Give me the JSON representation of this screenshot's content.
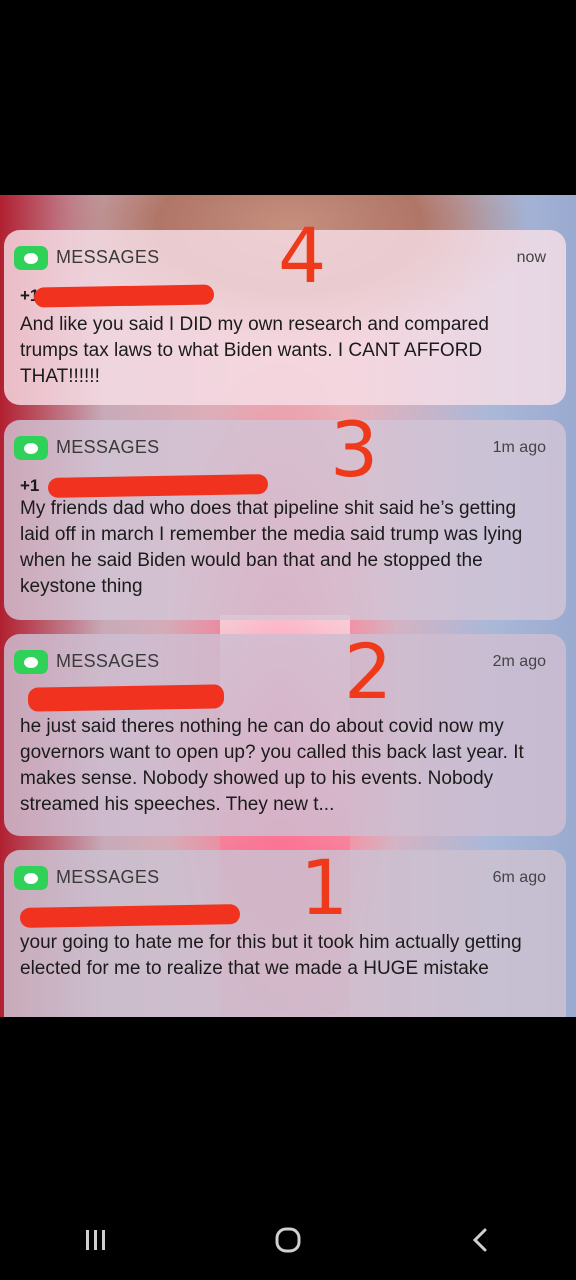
{
  "notifications": [
    {
      "app": "MESSAGES",
      "time": "now",
      "sender": "+1",
      "body": "And like you said I DID my own research and compared trumps tax laws to what Biden wants. I CANT AFFORD THAT!!!!!!",
      "annotation": "4"
    },
    {
      "app": "MESSAGES",
      "time": "1m ago",
      "sender": "+1",
      "body": "My friends dad who does that pipeline shit said he’s getting laid off in march I remember the media said trump was lying when he said Biden would ban that and he stopped the keystone thing",
      "annotation": "3"
    },
    {
      "app": "MESSAGES",
      "time": "2m ago",
      "sender": "",
      "body": "he just said theres nothing he can do about covid now my governors want to open up? you called this back last year. It makes sense. Nobody showed up to his events. Nobody streamed his speeches. They new t...",
      "annotation": "2"
    },
    {
      "app": "MESSAGES",
      "time": "6m ago",
      "sender": "",
      "body": "your going to hate me for this but it took him actually getting elected for me to realize that we made a HUGE mistake",
      "annotation": "1"
    }
  ],
  "colors": {
    "annotation": "#ee3a1a",
    "redaction": "#f0321e",
    "app_icon": "#2fd158"
  },
  "icons": {
    "app": "messages-icon",
    "nav_recents": "recents-icon",
    "nav_home": "home-icon",
    "nav_back": "back-icon"
  }
}
